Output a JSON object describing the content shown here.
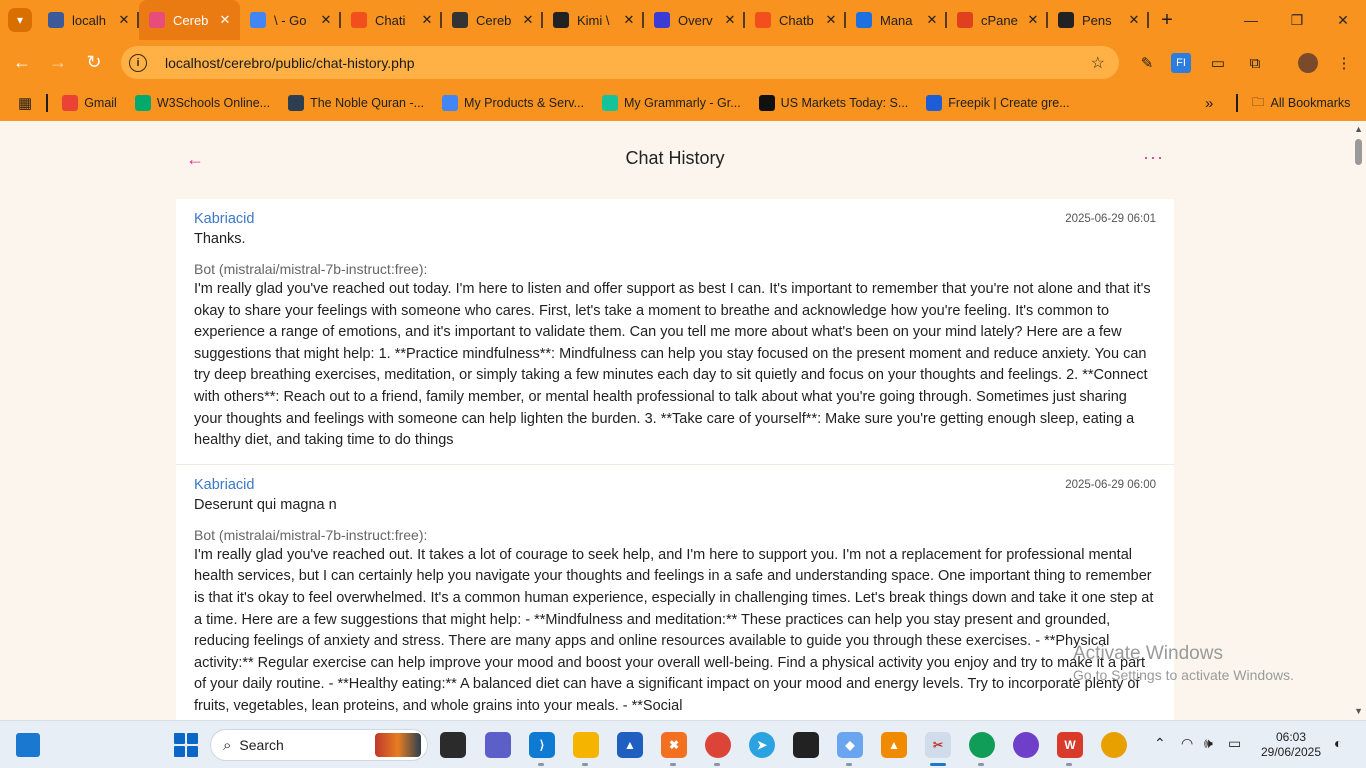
{
  "browser": {
    "tabs": [
      {
        "title": "localh",
        "color": "#3c5a9a",
        "active": false
      },
      {
        "title": "Cereb",
        "color": "#e84c7a",
        "active": true
      },
      {
        "title": "\\ - Go",
        "color": "#4285f4",
        "active": false
      },
      {
        "title": "Chati",
        "color": "#f24e1e",
        "active": false
      },
      {
        "title": "Cereb",
        "color": "#333333",
        "active": false
      },
      {
        "title": "Kimi \\",
        "color": "#222222",
        "active": false
      },
      {
        "title": "Overv",
        "color": "#3b3bd6",
        "active": false
      },
      {
        "title": "Chatb",
        "color": "#f24e1e",
        "active": false
      },
      {
        "title": "Mana",
        "color": "#1e6fe0",
        "active": false
      },
      {
        "title": "cPane",
        "color": "#e0401e",
        "active": false
      },
      {
        "title": "Pens",
        "color": "#222222",
        "active": false
      }
    ],
    "url": "localhost/cerebro/public/chat-history.php",
    "bookmarks": [
      {
        "label": "Gmail",
        "color": "#ea4335"
      },
      {
        "label": "W3Schools Online...",
        "color": "#04aa6d"
      },
      {
        "label": "The Noble Quran -...",
        "color": "#2c3e50"
      },
      {
        "label": "My Products & Serv...",
        "color": "#4285f4"
      },
      {
        "label": "My Grammarly - Gr...",
        "color": "#15c39a"
      },
      {
        "label": "US Markets Today: S...",
        "color": "#111111"
      },
      {
        "label": "Freepik | Create gre...",
        "color": "#1e5dd8"
      }
    ],
    "all_bookmarks_label": "All Bookmarks"
  },
  "page": {
    "title": "Chat History",
    "back_icon": "back-arrow-icon",
    "more_icon": "more-options-icon",
    "entries": [
      {
        "user": "Kabriacid",
        "timestamp": "2025-06-29 06:01",
        "user_message": "Thanks.",
        "bot_label": "Bot (mistralai/mistral-7b-instruct:free):",
        "bot_message": "I'm really glad you've reached out today. I'm here to listen and offer support as best I can. It's important to remember that you're not alone and that it's okay to share your feelings with someone who cares. First, let's take a moment to breathe and acknowledge how you're feeling. It's common to experience a range of emotions, and it's important to validate them. Can you tell me more about what's been on your mind lately? Here are a few suggestions that might help: 1. **Practice mindfulness**: Mindfulness can help you stay focused on the present moment and reduce anxiety. You can try deep breathing exercises, meditation, or simply taking a few minutes each day to sit quietly and focus on your thoughts and feelings. 2. **Connect with others**: Reach out to a friend, family member, or mental health professional to talk about what you're going through. Sometimes just sharing your thoughts and feelings with someone can help lighten the burden. 3. **Take care of yourself**: Make sure you're getting enough sleep, eating a healthy diet, and taking time to do things"
      },
      {
        "user": "Kabriacid",
        "timestamp": "2025-06-29 06:00",
        "user_message": "Deserunt qui magna n",
        "bot_label": "Bot (mistralai/mistral-7b-instruct:free):",
        "bot_message": "I'm really glad you've reached out. It takes a lot of courage to seek help, and I'm here to support you. I'm not a replacement for professional mental health services, but I can certainly help you navigate your thoughts and feelings in a safe and understanding space. One important thing to remember is that it's okay to feel overwhelmed. It's a common human experience, especially in challenging times. Let's break things down and take it one step at a time. Here are a few suggestions that might help: - **Mindfulness and meditation:** These practices can help you stay present and grounded, reducing feelings of anxiety and stress. There are many apps and online resources available to guide you through these exercises. - **Physical activity:** Regular exercise can help improve your mood and boost your overall well-being. Find a physical activity you enjoy and try to make it a part of your daily routine. - **Healthy eating:** A balanced diet can have a significant impact on your mood and energy levels. Try to incorporate plenty of fruits, vegetables, lean proteins, and whole grains into your meals. - **Social"
      }
    ]
  },
  "watermark": {
    "line1": "Activate Windows",
    "line2": "Go to Settings to activate Windows."
  },
  "taskbar": {
    "search_label": "Search",
    "time": "06:03",
    "date": "29/06/2025"
  },
  "colors": {
    "chrome_orange": "#f7931e",
    "accent_pink": "#d4368b",
    "username_blue": "#3b78c8"
  }
}
